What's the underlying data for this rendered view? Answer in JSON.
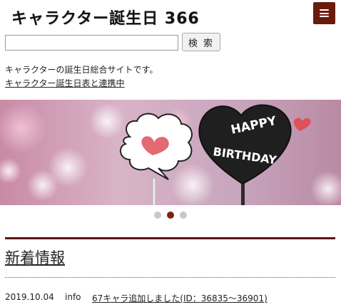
{
  "header": {
    "site_title": "キャラクター誕生日 366",
    "menu_icon": "hamburger-menu-icon"
  },
  "search": {
    "value": "",
    "placeholder": "",
    "button_label": "検 索"
  },
  "intro": {
    "description": "キャラクターの誕生日総合サイトです。",
    "link_label": "キャラクター誕生日表と連携中"
  },
  "banner": {
    "sign_line1": "HAPPY",
    "sign_line2": "BIRTHDAY"
  },
  "carousel": {
    "dots": 3,
    "active_index": 1
  },
  "news": {
    "heading": "新着情報",
    "items": [
      {
        "date": "2019.10.04",
        "category": "info",
        "text": "67キャラ追加しました(ID：36835～36901)"
      }
    ]
  },
  "colors": {
    "accent": "#6a1a0c",
    "dot_active": "#7a2410",
    "dot_inactive": "#c8c8c8"
  }
}
